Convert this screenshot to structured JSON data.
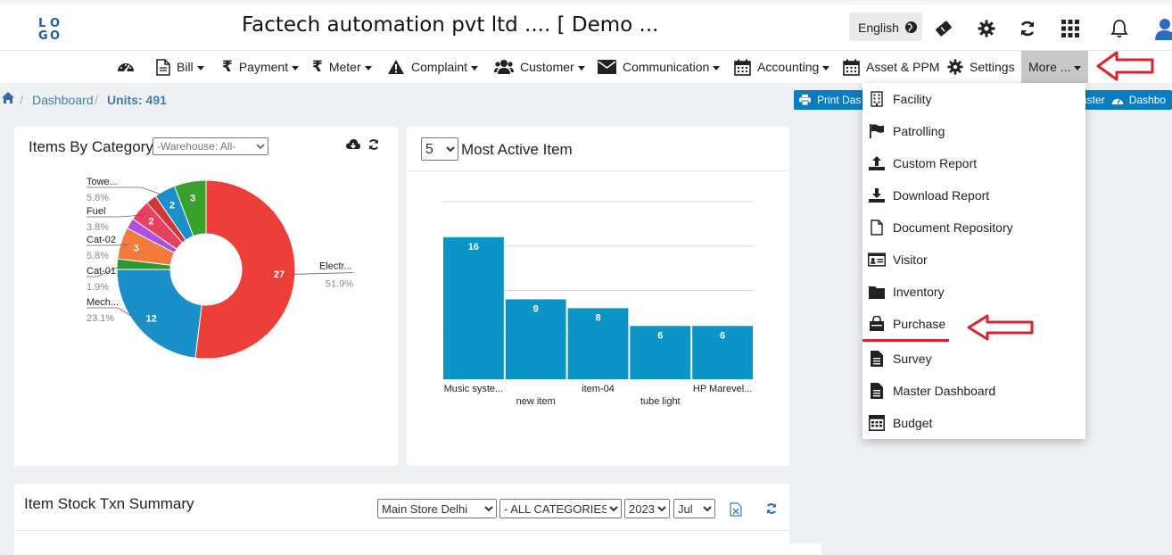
{
  "header": {
    "logo_text": "LOGO",
    "company_name": "Factech automation pvt ltd .... [ Demo ...",
    "language": "English"
  },
  "nav": {
    "items": [
      {
        "label": "Bill"
      },
      {
        "label": "Payment"
      },
      {
        "label": "Meter"
      },
      {
        "label": "Complaint"
      },
      {
        "label": "Customer"
      },
      {
        "label": "Communication"
      },
      {
        "label": "Accounting"
      },
      {
        "label": "Asset & PPM"
      },
      {
        "label": "Settings"
      },
      {
        "label": "More ..."
      }
    ]
  },
  "breadcrumb": {
    "dashboard": "Dashboard",
    "units": "Units: 491"
  },
  "buttons": {
    "print_dashboard": "Print Das",
    "master": "aster",
    "dashboard": "Dashbo"
  },
  "more_menu": [
    {
      "label": "Facility",
      "icon": "building-icon"
    },
    {
      "label": "Patrolling",
      "icon": "flag-icon"
    },
    {
      "label": "Custom Report",
      "icon": "upload-icon"
    },
    {
      "label": "Download Report",
      "icon": "download-icon"
    },
    {
      "label": "Document Repository",
      "icon": "file-icon"
    },
    {
      "label": "Visitor",
      "icon": "id-card-icon"
    },
    {
      "label": "Inventory",
      "icon": "folder-icon"
    },
    {
      "label": "Purchase",
      "icon": "shopping-bag-icon"
    },
    {
      "label": "Survey",
      "icon": "file-text-icon"
    },
    {
      "label": "Master Dashboard",
      "icon": "file-text-icon"
    },
    {
      "label": "Budget",
      "icon": "calculator-icon"
    }
  ],
  "items_by_category": {
    "title": "Items By Category",
    "warehouse_filter": "-Warehouse: All-"
  },
  "most_active": {
    "count_option": "5",
    "title": "Most Active Item"
  },
  "stock_summary": {
    "title": "Item Stock Txn Summary",
    "store": "Main Store Delhi",
    "category": "- ALL CATEGORIES -",
    "year": "2023",
    "month": "Jul"
  },
  "colors": {
    "accent": "#0a7dc0",
    "annotation_red": "#d9222a",
    "bar": "#0b95c6"
  },
  "chart_data": [
    {
      "type": "pie",
      "title": "Items By Category",
      "slices": [
        {
          "label": "Electr...",
          "value": 27,
          "percent": "51.9%",
          "color": "#ee3e3a"
        },
        {
          "label": "Mech...",
          "value": 12,
          "percent": "23.1%",
          "color": "#1a8fc9"
        },
        {
          "label": "Cat-01",
          "value": 1,
          "percent": "1.9%",
          "color": "#2e9a2e"
        },
        {
          "label": "Cat-02",
          "value": 3,
          "percent": "5.8%",
          "color": "#f47a3c"
        },
        {
          "label": "",
          "value": 1,
          "percent": "",
          "color": "#b04ee0"
        },
        {
          "label": "Fuel",
          "value": 2,
          "percent": "3.8%",
          "color": "#e84060"
        },
        {
          "label": "",
          "value": 1,
          "percent": "",
          "color": "#d63538"
        },
        {
          "label": "Towe...",
          "value": 2,
          "percent": "5.8%",
          "color": "#1a8fc9"
        },
        {
          "label": "",
          "value": 3,
          "percent": "",
          "color": "#37a12b"
        }
      ]
    },
    {
      "type": "bar",
      "title": "Most Active Item",
      "categories": [
        "Music syste...",
        "new item",
        "item-04",
        "tube light",
        "HP Marevel..."
      ],
      "values": [
        16,
        9,
        8,
        6,
        6
      ],
      "ylim": [
        0,
        20
      ]
    }
  ]
}
